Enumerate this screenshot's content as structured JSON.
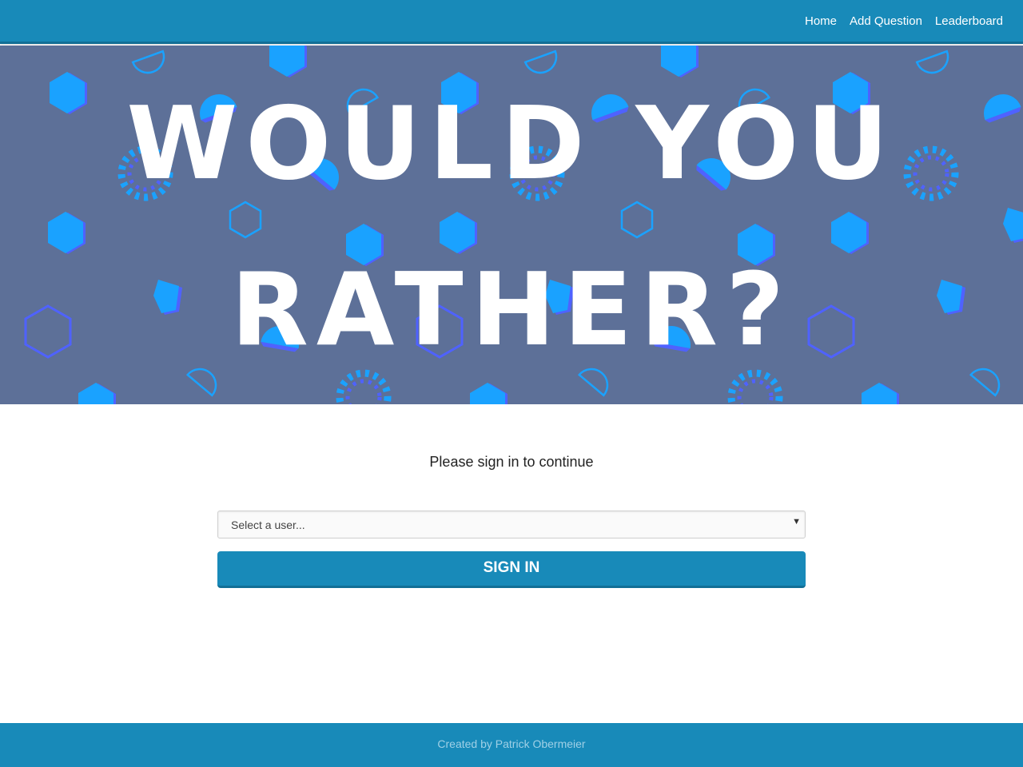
{
  "nav": {
    "items": [
      {
        "label": "Home"
      },
      {
        "label": "Add Question"
      },
      {
        "label": "Leaderboard"
      }
    ]
  },
  "hero": {
    "line1": "WOULD YOU",
    "line2": "RATHER?"
  },
  "signin": {
    "prompt": "Please sign in to continue",
    "select_value": "Select a user...",
    "button_label": "SIGN IN"
  },
  "footer": {
    "credit": "Created by Patrick Obermeier"
  },
  "colors": {
    "brand": "#188ab9",
    "hero_bg": "#5d7098",
    "shape_cyan": "#1aa2ff",
    "shape_blue": "#4f62ff"
  },
  "icons": {
    "select_arrow": "triangle-down-icon"
  }
}
